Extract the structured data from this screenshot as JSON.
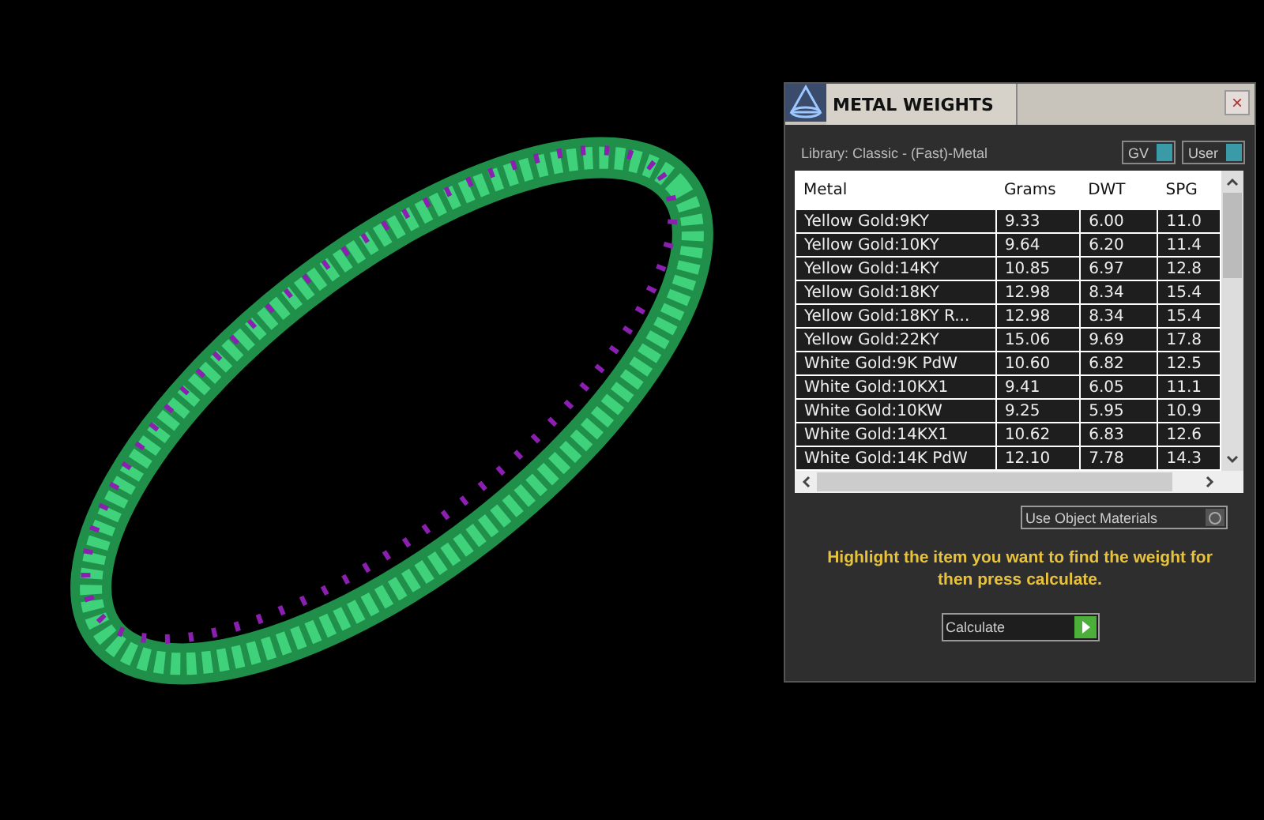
{
  "window": {
    "title": "METAL WEIGHTS",
    "close": "×"
  },
  "library": "Library: Classic - (Fast)-Metal",
  "toggles": [
    {
      "label": "GV",
      "on": true
    },
    {
      "label": "User",
      "on": true
    }
  ],
  "table": {
    "columns": [
      "Metal",
      "Grams",
      "DWT",
      "SPG"
    ],
    "rows": [
      [
        "Yellow Gold:9KY",
        "9.33",
        "6.00",
        "11.0"
      ],
      [
        "Yellow Gold:10KY",
        "9.64",
        "6.20",
        "11.4"
      ],
      [
        "Yellow Gold:14KY",
        "10.85",
        "6.97",
        "12.8"
      ],
      [
        "Yellow Gold:18KY",
        "12.98",
        "8.34",
        "15.4"
      ],
      [
        "Yellow Gold:18KY R...",
        "12.98",
        "8.34",
        "15.4"
      ],
      [
        "Yellow Gold:22KY",
        "15.06",
        "9.69",
        "17.8"
      ],
      [
        "White Gold:9K PdW",
        "10.60",
        "6.82",
        "12.5"
      ],
      [
        "White Gold:10KX1",
        "9.41",
        "6.05",
        "11.1"
      ],
      [
        "White Gold:10KW",
        "9.25",
        "5.95",
        "10.9"
      ],
      [
        "White Gold:14KX1",
        "10.62",
        "6.83",
        "12.6"
      ],
      [
        "White Gold:14K PdW",
        "12.10",
        "7.78",
        "14.3"
      ]
    ]
  },
  "use_object_materials": {
    "label": "Use Object Materials",
    "on": false
  },
  "hint": "Highlight the item you want to find the weight for then press calculate.",
  "calculate": {
    "label": "Calculate"
  }
}
